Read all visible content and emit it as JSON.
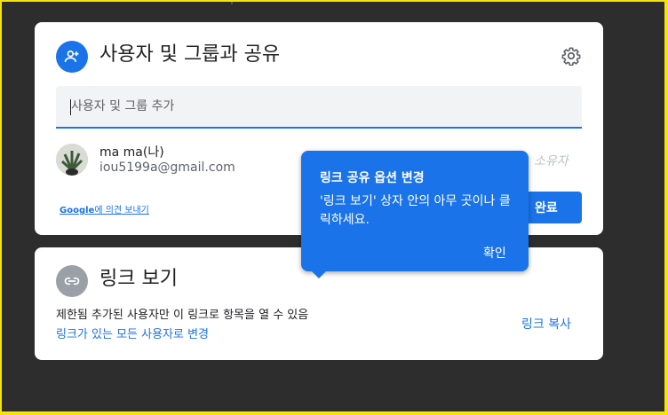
{
  "share": {
    "title": "사용자 및 그룹과 공유",
    "add_placeholder": "사용자 및 그룹 추가",
    "user": {
      "name": "ma ma(나)",
      "email": "iou5199a@gmail.com",
      "role": "소유자"
    },
    "feedback_brand": "Google",
    "feedback_rest": "에 의견 보내기",
    "done_label": "완료"
  },
  "link": {
    "title": "링크 보기",
    "restriction": "제한됨 추가된 사용자만 이 링크로 항목을 열 수 있음",
    "change_label": "링크가 있는 모든 사용자로 변경",
    "copy_label": "링크 복사"
  },
  "tooltip": {
    "title": "링크 공유 옵션 변경",
    "body": "'링크 보기' 상자 안의 아무 곳이나 클릭하세요.",
    "ok_label": "확인"
  },
  "colors": {
    "accent": "#1a73e8",
    "frame": "#f5e30b",
    "backdrop": "#2d2d2d"
  },
  "icons": {
    "share": "person-add-icon",
    "settings": "gear-icon",
    "link": "link-icon"
  }
}
